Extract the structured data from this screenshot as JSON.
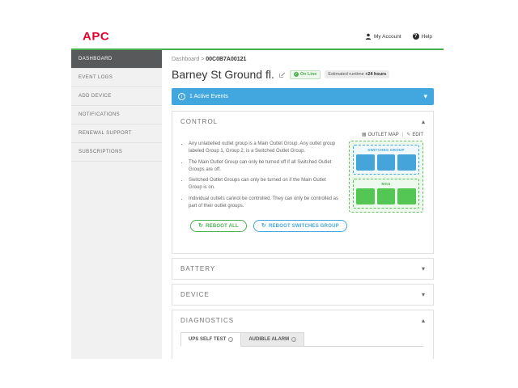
{
  "app": {
    "logo_text": "APC"
  },
  "topbar": {
    "my_account": "My Account",
    "help": "Help",
    "help_glyph": "?",
    "info_glyph": "i"
  },
  "sidebar": {
    "items": [
      {
        "label": "DASHBOARD"
      },
      {
        "label": "EVENT LOGS"
      },
      {
        "label": "ADD DEVICE"
      },
      {
        "label": "NOTIFICATIONS"
      },
      {
        "label": "RENEWAL SUPPORT"
      },
      {
        "label": "SUBSCRIPTIONS"
      }
    ]
  },
  "breadcrumb": {
    "root": "Dashboard",
    "separator": ">",
    "current": "00C0B7A00121"
  },
  "device": {
    "name": "Barney St Ground fl.",
    "status_badge": "On Line",
    "status_check": "✓",
    "runtime_label": "Estimated runtime ",
    "runtime_value": "+24 hours"
  },
  "events_banner": {
    "label": "1 Active Events",
    "chevron": "▾"
  },
  "control": {
    "title": "CONTROL",
    "chevron_expanded": "▴",
    "outlet_map_link": "OUTLET MAP",
    "links_divider": "|",
    "edit_link": "EDIT",
    "map_icon_glyph": "▦",
    "edit_icon_glyph": "✎",
    "notes": [
      "Any unlabelled outlet group is a Main Outlet Group. Any outlet group labeled Group 1, Group 2, is a Switched Outlet Group.",
      "The Main Outlet Group can only be turned off if all Switched Outlet Groups are off.",
      "Switched Outlet Groups can only be turned on if the Main Outlet Group is on.",
      "Individual outlets cannot be controlled. They can only be controlled as part of their outlet groups."
    ],
    "outlet_map": {
      "group1_name": "SWITCHES GROUP",
      "group2_name": "MGS",
      "group1_outlet_count": 3,
      "group2_outlet_count": 3
    },
    "reboot_all_label": "REBOOT ALL",
    "reboot_switches_label": "REBOOT SWITCHES GROUP",
    "refresh_glyph": "↻"
  },
  "sections": {
    "battery": "BATTERY",
    "device": "DEVICE",
    "diagnostics": "DIAGNOSTICS",
    "chevron_collapsed": "▾",
    "chevron_expanded": "▴"
  },
  "diagnostics": {
    "tab_self_test": "UPS SELF TEST",
    "tab_audible_alarm": "AUDIBLE ALARM"
  },
  "colors": {
    "brand_red": "#e4002b",
    "accent_green": "#43b049",
    "accent_blue": "#41a7de",
    "outlet_blue": "#45a4da",
    "outlet_green": "#53c653",
    "status_green": "#4caf50",
    "sidebar_active": "#58595b"
  }
}
